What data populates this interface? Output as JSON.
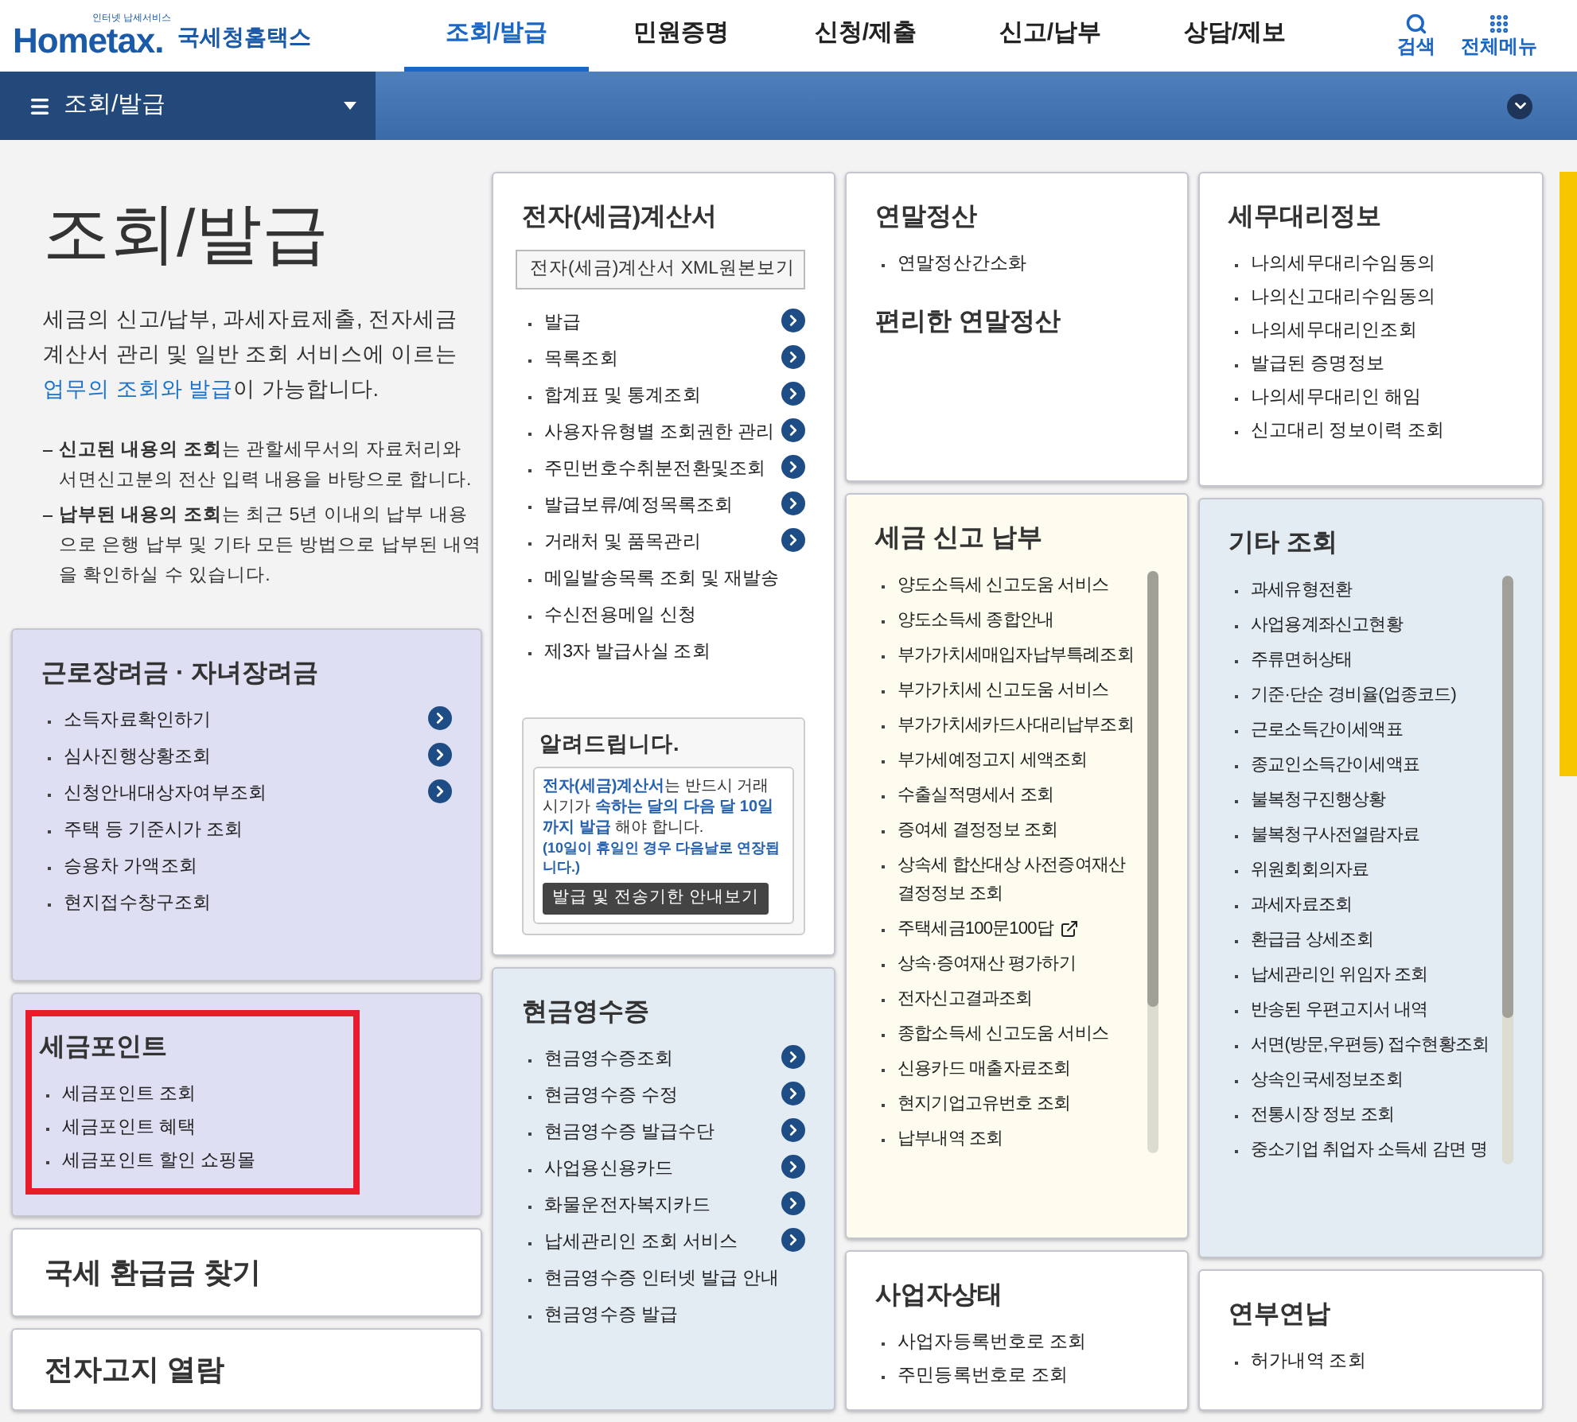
{
  "header": {
    "logo": {
      "tagline": "인터넷 납세서비스",
      "brand": "Hometax.",
      "name": "국세청홈택스"
    },
    "tabs": [
      {
        "label": "조회/발급",
        "selected": true
      },
      {
        "label": "민원증명",
        "selected": false
      },
      {
        "label": "신청/제출",
        "selected": false
      },
      {
        "label": "신고/납부",
        "selected": false
      },
      {
        "label": "상담/제보",
        "selected": false
      }
    ],
    "tools": [
      {
        "label": "검색",
        "kind": "search"
      },
      {
        "label": "전체메뉴",
        "kind": "grid"
      }
    ]
  },
  "location_bar": {
    "label": "조회/발급"
  },
  "intro": {
    "title": "조회/발급",
    "description": [
      {
        "text": "세금의 신고/납부, 과세자료제출, 전자세금계산서 관리 및 일반 조회 서비스에 이르는 ",
        "highlight": false
      },
      {
        "text": "업무의 조회와 발급",
        "highlight": true
      },
      {
        "text": "이 가능합니다.",
        "highlight": false
      }
    ],
    "notes": [
      "**신고된 내용의 조회**는 관할세무서의 자료처리와 서면신고분의 전산 입력 내용을 바탕으로 합니다.",
      "**납부된 내용의 조회**는 최근 5년 이내의 납부 내용으로 은행 납부 및 기타 모든 방법으로 납부된 내역을 확인하실 수 있습니다."
    ]
  },
  "columns": [
    [
      {
        "kind": "list",
        "color": "#dfdff3",
        "title": "근로장려금 · 자녀장려금",
        "items": [
          {
            "label": "소득자료확인하기",
            "arrow": true
          },
          {
            "label": "심사진행상황조회",
            "arrow": true
          },
          {
            "label": "신청안내대상자여부조회",
            "arrow": true
          },
          {
            "label": "주택 등 기준시가 조회",
            "arrow": false
          },
          {
            "label": "승용차 가액조회",
            "arrow": false
          },
          {
            "label": "현지접수창구조회",
            "arrow": false
          }
        ]
      },
      {
        "kind": "list",
        "color": "#dfdff3",
        "highlighted": true,
        "title": "세금포인트",
        "items": [
          {
            "label": "세금포인트 조회"
          },
          {
            "label": "세금포인트 혜택"
          },
          {
            "label": "세금포인트 할인 쇼핑몰"
          }
        ]
      },
      {
        "kind": "link",
        "color": "#ffffff",
        "title": "국세 환급금 찾기"
      },
      {
        "kind": "link",
        "color": "#ffffff",
        "title": "전자고지 열람"
      }
    ],
    [
      {
        "kind": "list",
        "color": "#ffffff",
        "title": "전자(세금)계산서",
        "button": "전자(세금)계산서 XML원본보기",
        "items": [
          {
            "label": "발급",
            "arrow": true
          },
          {
            "label": "목록조회",
            "arrow": true
          },
          {
            "label": "합계표 및 통계조회",
            "arrow": true
          },
          {
            "label": "사용자유형별 조회권한 관리",
            "arrow": true
          },
          {
            "label": "주민번호수취분전환및조회",
            "arrow": true
          },
          {
            "label": "발급보류/예정목록조회",
            "arrow": true
          },
          {
            "label": "거래처 및 품목관리",
            "arrow": true
          },
          {
            "label": "메일발송목록 조회 및 재발송",
            "arrow": false
          },
          {
            "label": "수신전용메일 신청",
            "arrow": false
          },
          {
            "label": "제3자 발급사실 조회",
            "arrow": false
          }
        ],
        "notice": {
          "title": "알려드립니다.",
          "text": [
            {
              "text": "전자(세금)계산서",
              "emphasis": true
            },
            {
              "text": "는 반드시 거래시기가 ",
              "emphasis": false
            },
            {
              "text": "속하는 달의 다음 달 10일까지 발급",
              "emphasis": true
            },
            {
              "text": " 해야 합니다.",
              "emphasis": false
            }
          ],
          "note": "(10일이 휴일인 경우 다음날로 연장됩니다.)",
          "button": "발급 및 전송기한 안내보기"
        }
      },
      {
        "kind": "list",
        "color": "#e3ebf3",
        "title": "현금영수증",
        "items": [
          {
            "label": "현금영수증조회",
            "arrow": true
          },
          {
            "label": "현금영수증 수정",
            "arrow": true
          },
          {
            "label": "현금영수증 발급수단",
            "arrow": true
          },
          {
            "label": "사업용신용카드",
            "arrow": true
          },
          {
            "label": "화물운전자복지카드",
            "arrow": true
          },
          {
            "label": "납세관리인 조회 서비스",
            "arrow": true
          },
          {
            "label": "현금영수증 인터넷 발급 안내",
            "arrow": false
          },
          {
            "label": "현금영수증 발급",
            "arrow": false
          }
        ]
      }
    ],
    [
      {
        "kind": "list",
        "color": "#ffffff",
        "title": "연말정산",
        "items": [
          {
            "label": "연말정산간소화"
          }
        ],
        "subtitle": "편리한 연말정산"
      },
      {
        "kind": "list",
        "color": "#fdfcef",
        "scroll": true,
        "title": "세금 신고 납부",
        "items": [
          {
            "label": "양도소득세 신고도움 서비스"
          },
          {
            "label": "양도소득세 종합안내"
          },
          {
            "label": "부가가치세매입자납부특례조회"
          },
          {
            "label": "부가가치세 신고도움 서비스"
          },
          {
            "label": "부가가치세카드사대리납부조회"
          },
          {
            "label": "부가세예정고지 세액조회"
          },
          {
            "label": "수출실적명세서 조회"
          },
          {
            "label": "증여세 결정정보 조회"
          },
          {
            "label": "상속세 합산대상 사전증여재산 결정정보 조회"
          },
          {
            "label": "주택세금100문100답",
            "external": true
          },
          {
            "label": "상속·증여재산 평가하기"
          },
          {
            "label": "전자신고결과조회"
          },
          {
            "label": "종합소득세 신고도움 서비스"
          },
          {
            "label": "신용카드 매출자료조회"
          },
          {
            "label": "현지기업고유번호 조회"
          },
          {
            "label": "납부내역 조회"
          }
        ]
      },
      {
        "kind": "list",
        "color": "#ffffff",
        "title": "사업자상태",
        "items": [
          {
            "label": "사업자등록번호로 조회"
          },
          {
            "label": "주민등록번호로 조회"
          }
        ]
      }
    ],
    [
      {
        "kind": "list",
        "color": "#ffffff",
        "title": "세무대리정보",
        "items": [
          {
            "label": "나의세무대리수임동의"
          },
          {
            "label": "나의신고대리수임동의"
          },
          {
            "label": "나의세무대리인조회"
          },
          {
            "label": "발급된 증명정보"
          },
          {
            "label": "나의세무대리인 해임"
          },
          {
            "label": "신고대리 정보이력 조회"
          }
        ]
      },
      {
        "kind": "list",
        "color": "#e3ebf3",
        "scroll": true,
        "title": "기타 조회",
        "items": [
          {
            "label": "과세유형전환"
          },
          {
            "label": "사업용계좌신고현황"
          },
          {
            "label": "주류면허상태"
          },
          {
            "label": "기준·단순 경비율(업종코드)"
          },
          {
            "label": "근로소득간이세액표"
          },
          {
            "label": "종교인소득간이세액표"
          },
          {
            "label": "불복청구진행상황"
          },
          {
            "label": "불복청구사전열람자료"
          },
          {
            "label": "위원회회의자료"
          },
          {
            "label": "과세자료조회"
          },
          {
            "label": "환급금 상세조회"
          },
          {
            "label": "납세관리인 위임자 조회"
          },
          {
            "label": "반송된 우편고지서 내역"
          },
          {
            "label": "서면(방문,우편등) 접수현황조회"
          },
          {
            "label": "상속인국세정보조회"
          },
          {
            "label": "전통시장 정보 조회"
          },
          {
            "label": "중소기업 취업자 소득세 감면 명"
          }
        ]
      },
      {
        "kind": "list",
        "color": "#ffffff",
        "title": "연부연납",
        "items": [
          {
            "label": "허가내역 조회"
          }
        ]
      }
    ]
  ]
}
